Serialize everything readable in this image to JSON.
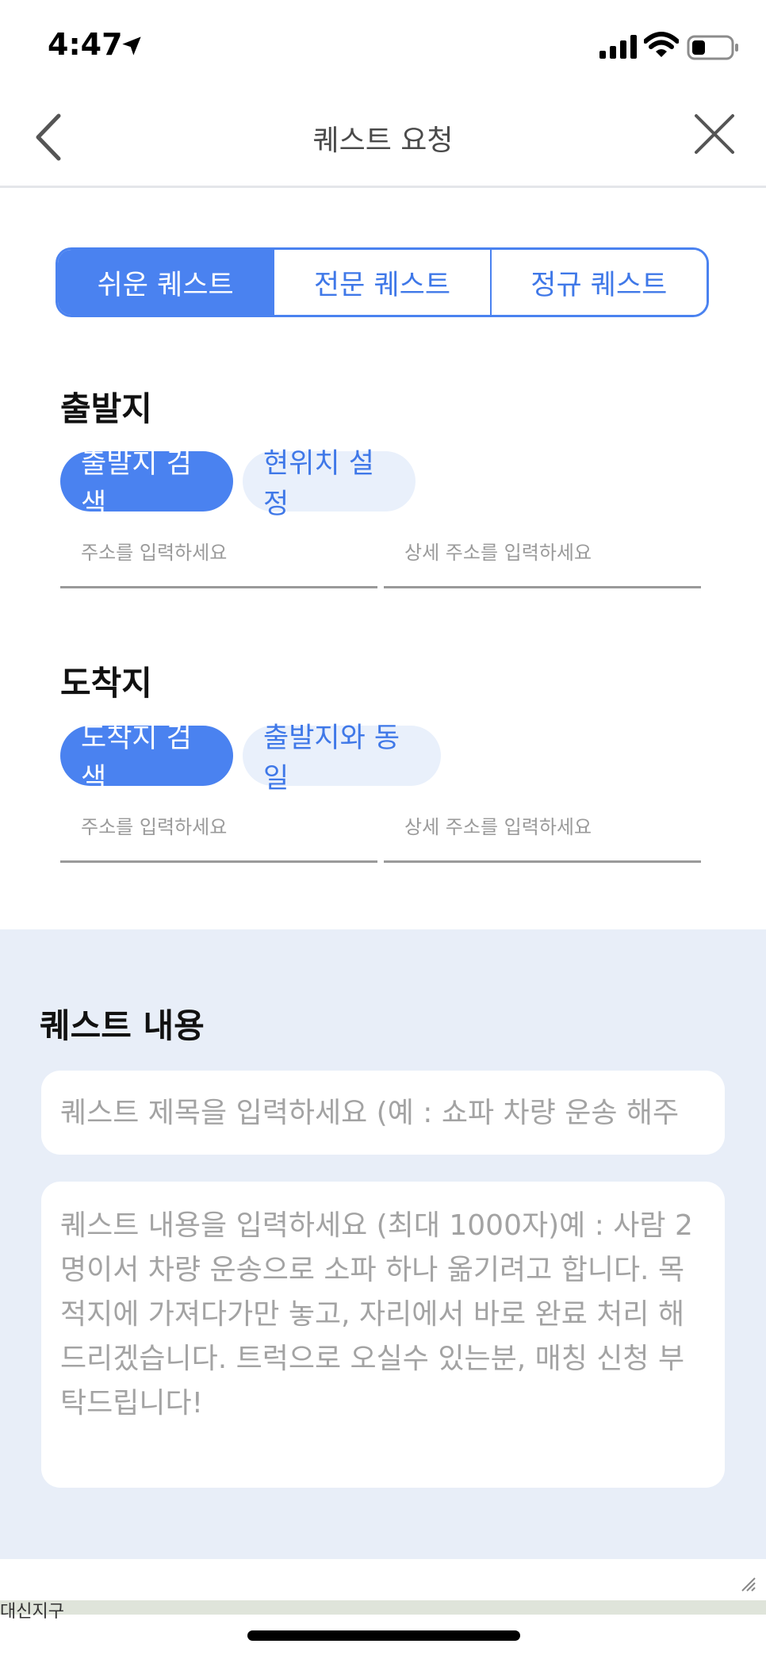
{
  "status_bar": {
    "time": "4:47"
  },
  "nav": {
    "title": "퀘스트 요청"
  },
  "tabs": [
    {
      "label": "쉬운 퀘스트",
      "active": true
    },
    {
      "label": "전문 퀘스트",
      "active": false
    },
    {
      "label": "정규 퀘스트",
      "active": false
    }
  ],
  "departure": {
    "title": "출발지",
    "search_button": "출발지 검색",
    "secondary_button": "현위치 설정",
    "address_placeholder": "주소를 입력하세요",
    "detail_placeholder": "상세 주소를 입력하세요"
  },
  "arrival": {
    "title": "도착지",
    "search_button": "도착지 검색",
    "secondary_button": "출발지와 동일",
    "address_placeholder": "주소를 입력하세요",
    "detail_placeholder": "상세 주소를 입력하세요"
  },
  "content": {
    "title": "퀘스트 내용",
    "title_placeholder": "퀘스트 제목을 입력하세요 (예 : 쇼파 차량 운송 해주",
    "body_placeholder": "퀘스트 내용을 입력하세요 (최대 1000자)예 : 사람 2 명이서 차량 운송으로 소파 하나 옮기려고 합니다. 목적지에 가져다가만 놓고, 자리에서 바로 완료 처리 해드리겠습니다. 트럭으로 오실수 있는분, 매칭 신청 부탁드립니다!"
  },
  "background_map_text": "대신지구",
  "colors": {
    "accent": "#4a82f0",
    "accent_light": "#e9f0fb",
    "content_bg": "#e8eef8"
  },
  "icons": [
    "location-arrow-icon",
    "cellular-signal-icon",
    "wifi-icon",
    "battery-icon",
    "back-chevron-icon",
    "close-icon",
    "resize-handle-icon"
  ]
}
